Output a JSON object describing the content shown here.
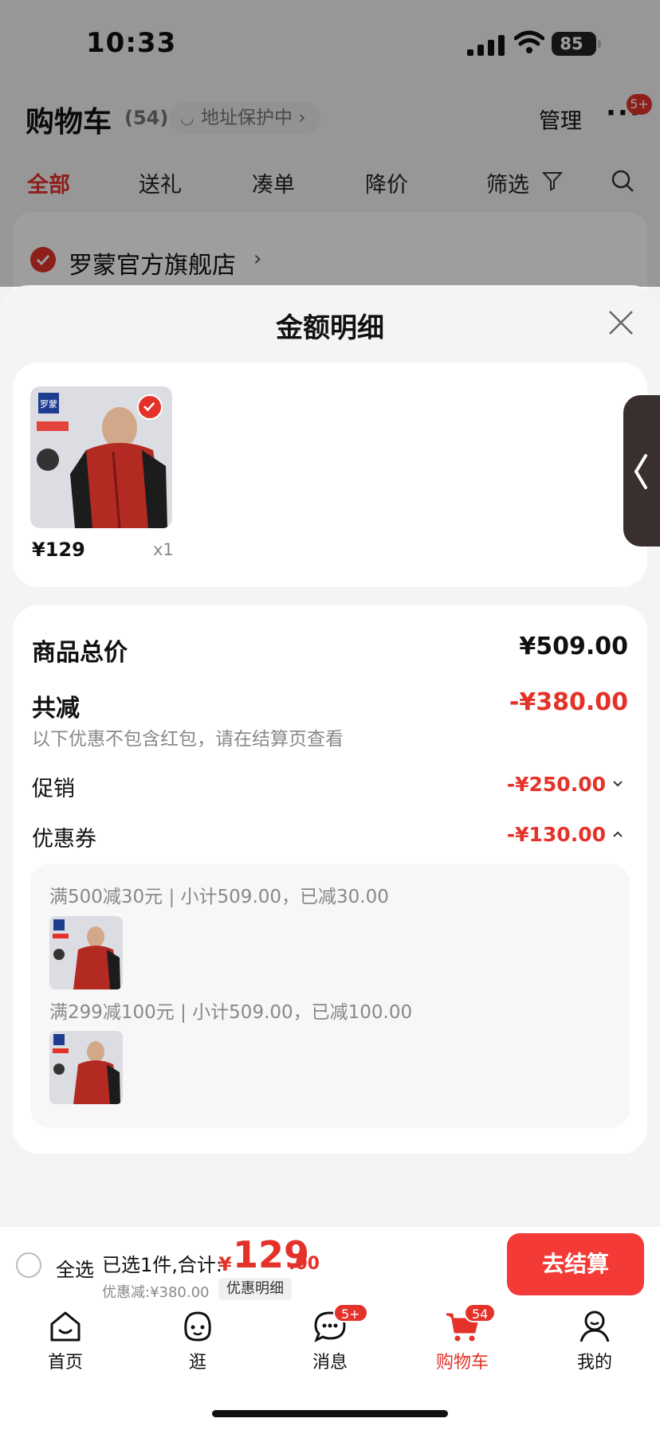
{
  "status_bar": {
    "time": "10:33",
    "battery": "85"
  },
  "header": {
    "title": "购物车",
    "count": "(54)",
    "address_protect": "地址保护中",
    "manage": "管理",
    "more_badge": "5+"
  },
  "tabs": [
    "全部",
    "送礼",
    "凑单",
    "降价",
    "筛选"
  ],
  "store": {
    "name": "罗蒙官方旗舰店"
  },
  "sheet": {
    "title": "金额明细",
    "product": {
      "price": "¥129",
      "qty": "x1"
    },
    "summary": {
      "total_label": "商品总价",
      "total_value": "¥509.00",
      "reduce_label": "共减",
      "reduce_value": "-¥380.00",
      "hint": "以下优惠不包含红包，请在结算页查看",
      "promo_label": "促销",
      "promo_value": "-¥250.00",
      "coupon_label": "优惠券",
      "coupon_value": "-¥130.00"
    },
    "coupons": [
      {
        "text": "满500减30元 | 小计509.00，已减30.00"
      },
      {
        "text": "满299减100元 | 小计509.00，已减100.00"
      }
    ]
  },
  "bottom": {
    "select_all": "全选",
    "selected_summary": "已选1件,合计:",
    "total_yen": "¥",
    "total_int": "129",
    "total_dec": ".00",
    "discount_text": "优惠减:¥380.00",
    "detail_link": "优惠明细",
    "checkout": "去结算"
  },
  "tabbar": [
    {
      "label": "首页",
      "icon": "home-icon"
    },
    {
      "label": "逛",
      "icon": "discover-icon"
    },
    {
      "label": "消息",
      "icon": "message-icon",
      "badge": "5+"
    },
    {
      "label": "购物车",
      "icon": "cart-icon",
      "badge": "54",
      "active": true
    },
    {
      "label": "我的",
      "icon": "profile-icon"
    }
  ],
  "colors": {
    "accent": "#e4322a",
    "checkout": "#f33a36"
  }
}
